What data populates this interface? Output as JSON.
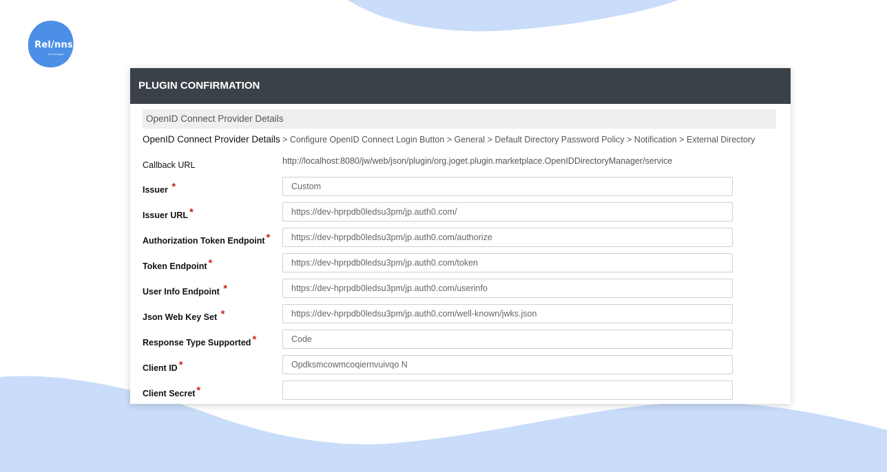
{
  "brand": {
    "name": "Rel/nns",
    "tagline": "Technologies",
    "colors": {
      "blob": "#4c8fe6",
      "wave": "#c9dcfa"
    }
  },
  "panel": {
    "title": "PLUGIN CONFIRMATION",
    "section_title": "OpenID Connect Provider Details",
    "breadcrumb": {
      "current": "OpenID Connect Provider Details",
      "steps": [
        "Configure OpenID Connect Login Button",
        "General",
        "Default Directory Password Policy",
        "Notification",
        "External Directory"
      ],
      "separator": ">"
    }
  },
  "form": {
    "callback": {
      "label": "Callback URL",
      "value": "http://localhost:8080/jw/web/json/plugin/org.joget.plugin.marketplace.OpenIDDirectoryManager/service"
    },
    "required_mark": "*",
    "fields": [
      {
        "label": "Issuer",
        "value": "Custom"
      },
      {
        "label": "Issuer URL",
        "value": "https://dev-hprpdb0ledsu3pm/jp.auth0.com/"
      },
      {
        "label": "Authorization Token Endpoint",
        "value": "https://dev-hprpdb0ledsu3pm/jp.auth0.com/authorize"
      },
      {
        "label": "Token Endpoint",
        "value": "https://dev-hprpdb0ledsu3pm/jp.auth0.com/token"
      },
      {
        "label": "User Info Endpoint",
        "value": "https://dev-hprpdb0ledsu3pm/jp.auth0.com/userinfo"
      },
      {
        "label": "Json Web Key Set",
        "value": "https://dev-hprpdb0ledsu3pm/jp.auth0.com/well-known/jwks.json"
      },
      {
        "label": "Response Type Supported",
        "value": "Code"
      },
      {
        "label": "Client ID",
        "value": "Opdksmcowmcoqiernvuivqo N"
      },
      {
        "label": "Client Secret",
        "value": ""
      }
    ]
  }
}
